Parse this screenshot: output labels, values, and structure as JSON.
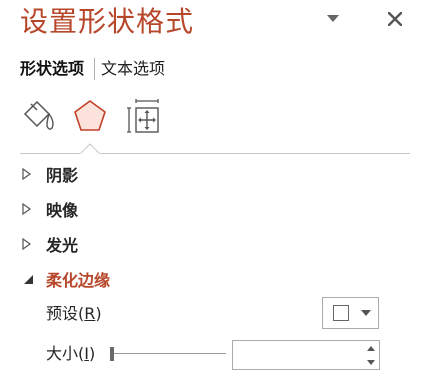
{
  "pane": {
    "title": "设置形状格式",
    "dropdown_icon": "chevron-down-icon",
    "close_icon": "close-icon"
  },
  "tabs": [
    {
      "label": "形状选项",
      "active": true
    },
    {
      "label": "文本选项",
      "active": false
    }
  ],
  "category_icons": [
    "fill-line-icon",
    "effects-icon",
    "size-properties-icon"
  ],
  "sections": [
    {
      "label": "阴影",
      "expanded": false
    },
    {
      "label": "映像",
      "expanded": false
    },
    {
      "label": "发光",
      "expanded": false
    },
    {
      "label": "柔化边缘",
      "expanded": true
    }
  ],
  "soft_edges": {
    "preset": {
      "label_prefix": "预设(",
      "access_key": "R",
      "label_suffix": ")"
    },
    "size": {
      "label_prefix": "大小(",
      "access_key": "I",
      "label_suffix": ")",
      "value": "",
      "slider_level": 0
    }
  },
  "colors": {
    "accent": "#b7472a",
    "text": "#262626",
    "border": "#ababab"
  }
}
